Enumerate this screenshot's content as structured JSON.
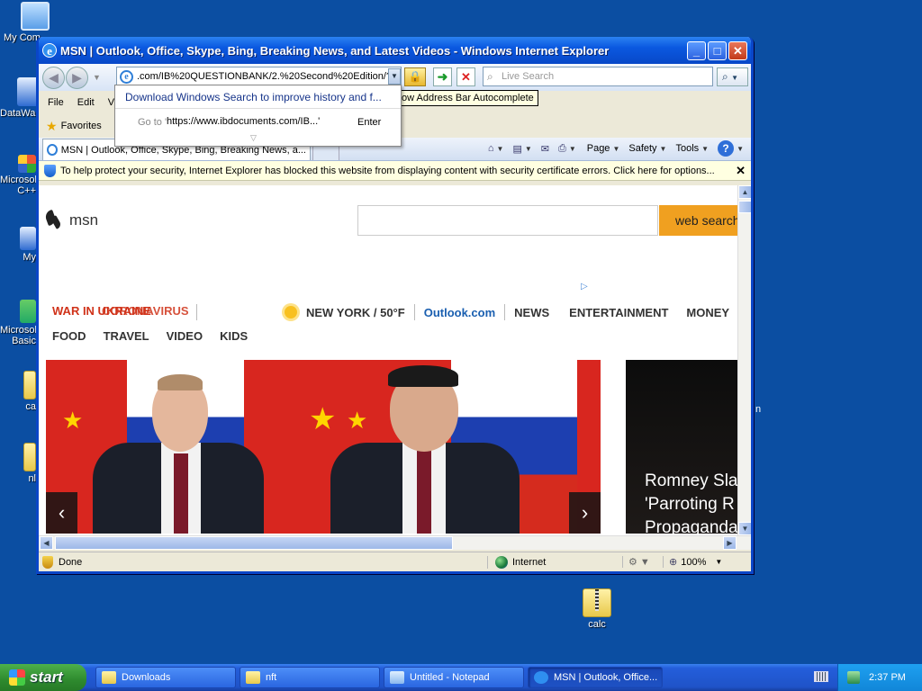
{
  "desktop": {
    "icons": [
      {
        "label": "My Com"
      },
      {
        "label": "DataWa"
      },
      {
        "label": "Microsol C++"
      },
      {
        "label": "My"
      },
      {
        "label": "Microsol Basic"
      },
      {
        "label": "ca"
      },
      {
        "label": "nl"
      },
      {
        "label": "calc"
      }
    ],
    "stray_label": "n"
  },
  "window": {
    "title": "MSN | Outlook, Office, Skype, Bing, Breaking News, and Latest Videos - Windows Internet Explorer",
    "minimize": "_",
    "maximize": "□",
    "close": "✕"
  },
  "navbar": {
    "address": ".com/IB%20QUESTIONBANK/2.%20Second%20Edition/?",
    "live_search_placeholder": "Live Search"
  },
  "menubar": {
    "items": [
      "File",
      "Edit",
      "Vi"
    ],
    "tooltip": "ow Address Bar Autocomplete"
  },
  "favorites": {
    "label": "Favorites"
  },
  "tab": {
    "title": "MSN | Outlook, Office, Skype, Bing, Breaking News, a..."
  },
  "command_bar": {
    "page": "Page",
    "safety": "Safety",
    "tools": "Tools"
  },
  "infobar": {
    "text": "To help protect your security, Internet Explorer has blocked this website from displaying content with security certificate errors. Click here for options...",
    "close": "✕"
  },
  "address_dropdown": {
    "suggestion": "Download Windows Search to improve history and f...",
    "goto_label": "Go to '",
    "goto_url": "https://www.ibdocuments.com/IB...'",
    "enter": "Enter"
  },
  "msn": {
    "logo_text": "msn",
    "search_button": "web search",
    "nav1": {
      "war_a": "WAR IN UKRAINE",
      "war_b": "CORONAVIRUS",
      "weather": "NEW YORK / 50°F",
      "outlook": "Outlook.com",
      "news": "NEWS",
      "entertainment": "ENTERTAINMENT",
      "money": "MONEY"
    },
    "nav2": [
      "FOOD",
      "TRAVEL",
      "VIDEO",
      "KIDS"
    ],
    "side_headline": "Romney Sla\n'Parroting R\nPropaganda"
  },
  "statusbar": {
    "done": "Done",
    "zone": "Internet",
    "zoom": "100%"
  },
  "taskbar": {
    "start": "start",
    "tasks": [
      {
        "label": "Downloads"
      },
      {
        "label": "nft"
      },
      {
        "label": "Untitled - Notepad"
      },
      {
        "label": "MSN | Outlook, Office..."
      }
    ],
    "clock": "2:37 PM"
  }
}
